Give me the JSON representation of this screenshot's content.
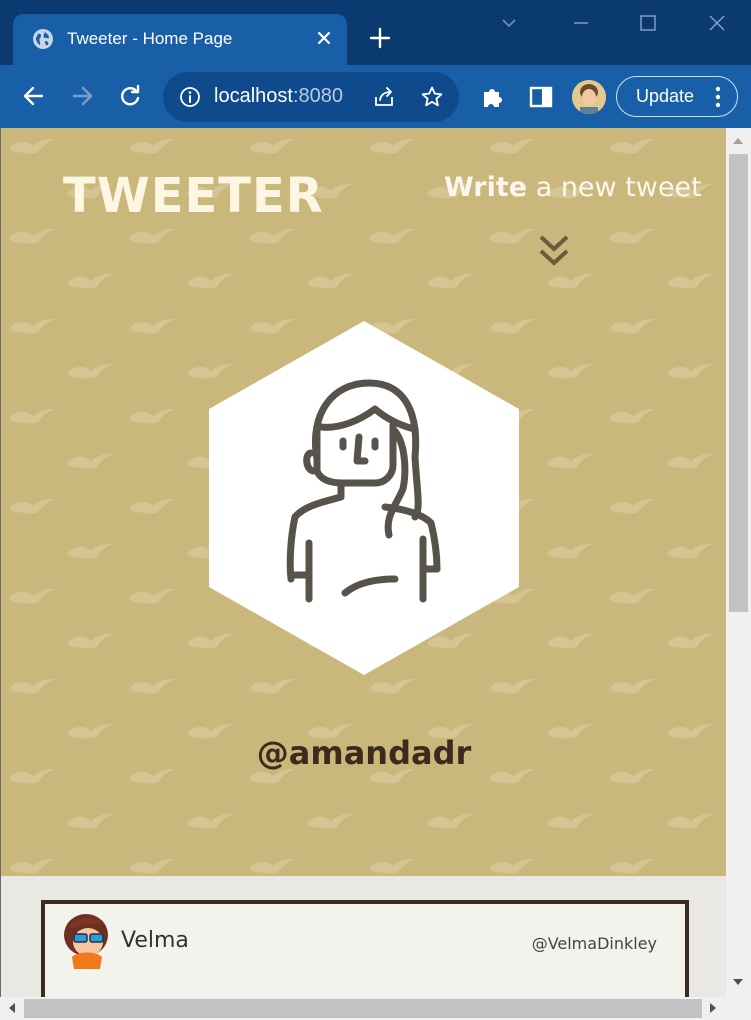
{
  "browser": {
    "tab_title": "Tweeter - Home Page",
    "url_host": "localhost",
    "url_port": ":8080",
    "update_label": "Update"
  },
  "header": {
    "logo": "TWEETER",
    "write_strong": "Write",
    "write_rest": " a new tweet"
  },
  "profile": {
    "handle": "@amandadr"
  },
  "tweets": [
    {
      "name": "Velma",
      "handle": "@VelmaDinkley"
    }
  ],
  "colors": {
    "hero_bg": "#c9b77b",
    "brand_dark": "#3b2a1e",
    "chrome_dark": "#0b3a71",
    "chrome_tab": "#185fa8"
  },
  "icons": [
    "globe-icon",
    "close-icon",
    "plus-icon",
    "back-icon",
    "forward-icon",
    "reload-icon",
    "info-icon",
    "share-icon",
    "star-icon",
    "extensions-icon",
    "sidebar-icon",
    "kebab-icon",
    "chevron-double-down-icon",
    "avatar-icon"
  ]
}
